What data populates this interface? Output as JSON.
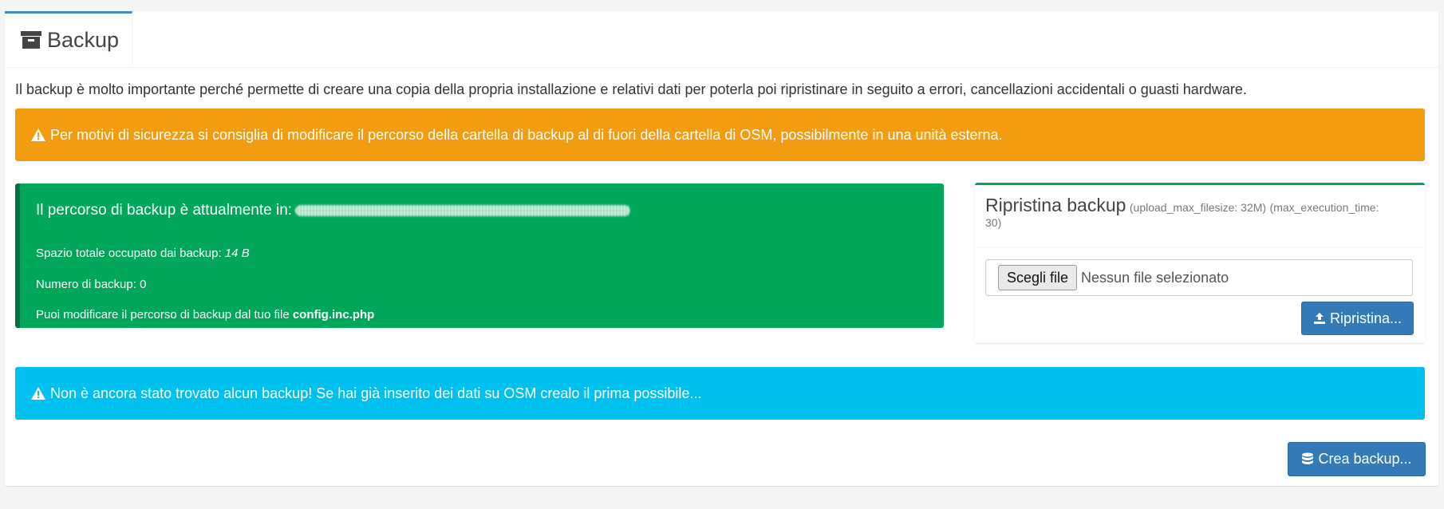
{
  "tab": {
    "label": "Backup",
    "icon": "archive-icon"
  },
  "intro": "Il backup è molto importante perché permette di creare una copia della propria installazione e relativi dati per poterla poi ripristinare in seguito a errori, cancellazioni accidentali o guasti hardware.",
  "warning_alert": {
    "text": "Per motivi di sicurezza si consiglia di modificare il percorso della cartella di backup al di fuori della cartella di OSM, possibilmente in una unità esterna.",
    "color": "#f39c12"
  },
  "callout": {
    "path_label": "Il percorso di backup è attualmente in:",
    "space_label": "Spazio totale occupato dai backup: ",
    "space_value": "14 B",
    "count_label": "Numero di backup: 0",
    "config_label": "Puoi modificare il percorso di backup dal tuo file ",
    "config_file": "config.inc.php",
    "color": "#00a65a"
  },
  "restore_panel": {
    "title": "Ripristina backup",
    "upload_max": "(upload_max_filesize: 32M)",
    "max_exec": "(max_execution_time:",
    "max_exec_value": "30)",
    "file_button": "Scegli file",
    "file_status": "Nessun file selezionato",
    "restore_button": "Ripristina..."
  },
  "info_alert": {
    "text": "Non è ancora stato trovato alcun backup! Se hai già inserito dei dati su OSM crealo il prima possibile...",
    "color": "#00c0ef"
  },
  "create_button": "Crea backup..."
}
